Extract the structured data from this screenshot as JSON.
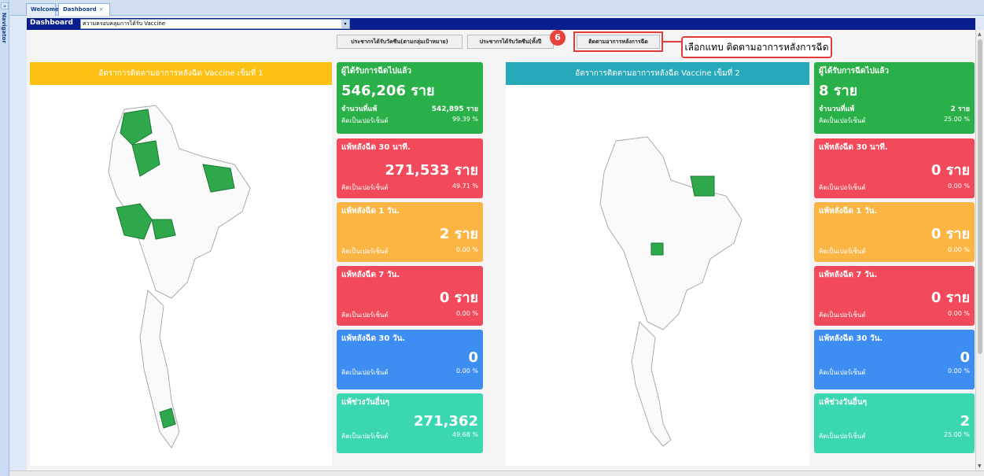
{
  "navigator": {
    "toggle": "»",
    "label": "Navigator"
  },
  "tabs": [
    {
      "label": "Welcome"
    },
    {
      "label": "Dashboard",
      "close": "×"
    }
  ],
  "toolbar": {
    "title": "Dashboard",
    "select_value": "ความครอบคลุมการได้รับ Vaccine",
    "select_arrow": "▾"
  },
  "buttons": [
    {
      "label": "ประชากรได้รับวัคซีน(ตามกลุ่มเป้าหมาย)"
    },
    {
      "label": "ประชากรได้รับวัคซีน(ทั้งปี"
    },
    {
      "label": "ติดตามอาการหลังการฉีด"
    }
  ],
  "annotation": {
    "step": "6",
    "callout": "เลือกแทบ ติดตามอาการหลังการฉีด"
  },
  "panel1": {
    "title": "อัตราการติดตามอาการหลังฉีด Vaccine เข็มที่ 1",
    "color": "#fdc014"
  },
  "panel2": {
    "title": "อัตราการติดตามอาการหลังฉีด Vaccine เข็มที่ 2",
    "color": "#26a9b8"
  },
  "cards1": [
    {
      "title": "ผู้ได้รับการฉีดไปแล้ว",
      "big": "546,206 ราย",
      "r1l": "จำนวนที่แพ้",
      "r1r": "542,895 ราย",
      "r2l": "คิดเป็นเปอร์เซ็นต์",
      "r2r": "99.39 %"
    },
    {
      "title": "แพ้หลังฉีด 30 นาที.",
      "big": "271,533 ราย",
      "r2l": "คิดเป็นเปอร์เซ็นต์",
      "r2r": "49.71 %"
    },
    {
      "title": "แพ้หลังฉีด 1 วัน.",
      "big": "2 ราย",
      "r2l": "คิดเป็นเปอร์เซ็นต์",
      "r2r": "0.00 %"
    },
    {
      "title": "แพ้หลังฉีด 7 วัน.",
      "big": "0 ราย",
      "r2l": "คิดเป็นเปอร์เซ็นต์",
      "r2r": "0.00 %"
    },
    {
      "title": "แพ้หลังฉีด 30 วัน.",
      "big": "0",
      "r2l": "คิดเป็นเปอร์เซ็นต์",
      "r2r": "0.00 %"
    },
    {
      "title": "แพ้ช่วงวันอื่นๆ",
      "big": "271,362",
      "r2l": "คิดเป็นเปอร์เซ็นต์",
      "r2r": "49.68 %"
    }
  ],
  "cards2": [
    {
      "title": "ผู้ได้รับการฉีดไปแล้ว",
      "big": "8 ราย",
      "r1l": "จำนวนที่แพ้",
      "r1r": "2 ราย",
      "r2l": "คิดเป็นเปอร์เซ็นต์",
      "r2r": "25.00 %"
    },
    {
      "title": "แพ้หลังฉีด 30 นาที.",
      "big": "0 ราย",
      "r2l": "คิดเป็นเปอร์เซ็นต์",
      "r2r": "0.00 %"
    },
    {
      "title": "แพ้หลังฉีด 1 วัน.",
      "big": "0 ราย",
      "r2l": "คิดเป็นเปอร์เซ็นต์",
      "r2r": "0.00 %"
    },
    {
      "title": "แพ้หลังฉีด 7 วัน.",
      "big": "0 ราย",
      "r2l": "คิดเป็นเปอร์เซ็นต์",
      "r2r": "0.00 %"
    },
    {
      "title": "แพ้หลังฉีด 30 วัน.",
      "big": "0",
      "r2l": "คิดเป็นเปอร์เซ็นต์",
      "r2r": "0.00 %"
    },
    {
      "title": "แพ้ช่วงวันอื่นๆ",
      "big": "2",
      "r2l": "คิดเป็นเปอร์เซ็นต์",
      "r2r": "25.00 %"
    }
  ],
  "colors": {
    "green": "#2ab048",
    "red": "#f24a5b",
    "orange": "#fbb545",
    "blue": "#3d8df2",
    "teal": "#3bd6b2",
    "toolbar": "#0a1f8f"
  }
}
